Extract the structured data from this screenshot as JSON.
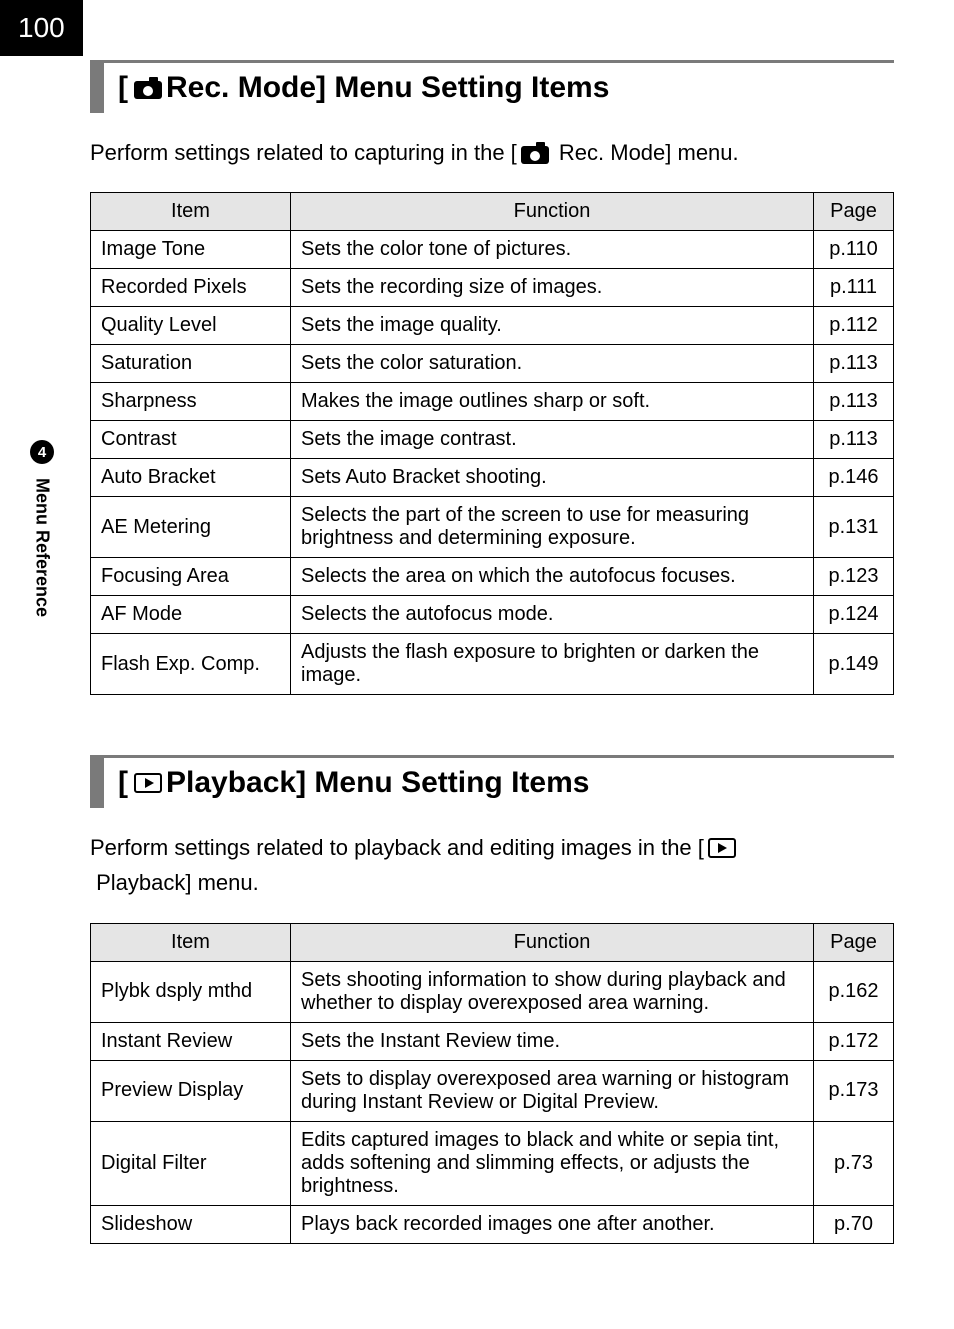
{
  "pageNumber": "100",
  "sideTab": {
    "number": "4",
    "label": "Menu Reference"
  },
  "section1": {
    "titlePrefix": "[",
    "titleText": " Rec. Mode] Menu Setting Items",
    "introBefore": "Perform settings related to capturing in the [",
    "introAfter": " Rec. Mode] menu.",
    "headers": {
      "item": "Item",
      "function": "Function",
      "page": "Page"
    },
    "rows": [
      {
        "item": "Image Tone",
        "function": "Sets the color tone of pictures.",
        "page": "p.110"
      },
      {
        "item": "Recorded Pixels",
        "function": "Sets the recording size of images.",
        "page": "p.111"
      },
      {
        "item": "Quality Level",
        "function": "Sets the image quality.",
        "page": "p.112"
      },
      {
        "item": "Saturation",
        "function": "Sets the color saturation.",
        "page": "p.113"
      },
      {
        "item": "Sharpness",
        "function": "Makes the image outlines sharp or soft.",
        "page": "p.113"
      },
      {
        "item": "Contrast",
        "function": "Sets the image contrast.",
        "page": "p.113"
      },
      {
        "item": "Auto Bracket",
        "function": "Sets Auto Bracket shooting.",
        "page": "p.146"
      },
      {
        "item": "AE Metering",
        "function": "Selects the part of the screen to use for measuring brightness and determining exposure.",
        "page": "p.131"
      },
      {
        "item": "Focusing Area",
        "function": "Selects the area on which the autofocus focuses.",
        "page": "p.123"
      },
      {
        "item": "AF Mode",
        "function": "Selects the autofocus mode.",
        "page": "p.124"
      },
      {
        "item": "Flash Exp. Comp.",
        "function": "Adjusts the flash exposure to brighten or darken the image.",
        "page": "p.149"
      }
    ]
  },
  "section2": {
    "titlePrefix": "[",
    "titleText": " Playback] Menu Setting Items",
    "introBefore": "Perform settings related to playback and editing images in the ",
    "introMid": "[",
    "introAfter": " Playback] menu.",
    "headers": {
      "item": "Item",
      "function": "Function",
      "page": "Page"
    },
    "rows": [
      {
        "item": "Plybk dsply mthd",
        "function": "Sets shooting information to show during playback and whether to display overexposed area warning.",
        "page": "p.162"
      },
      {
        "item": "Instant Review",
        "function": "Sets the Instant Review time.",
        "page": "p.172"
      },
      {
        "item": "Preview Display",
        "function": "Sets to display overexposed area warning or histogram during Instant Review or Digital Preview.",
        "page": "p.173"
      },
      {
        "item": "Digital Filter",
        "function": "Edits captured images to black and white or sepia tint, adds softening and slimming effects, or adjusts the brightness.",
        "page": "p.73"
      },
      {
        "item": "Slideshow",
        "function": "Plays back recorded images one after another.",
        "page": "p.70"
      }
    ]
  }
}
